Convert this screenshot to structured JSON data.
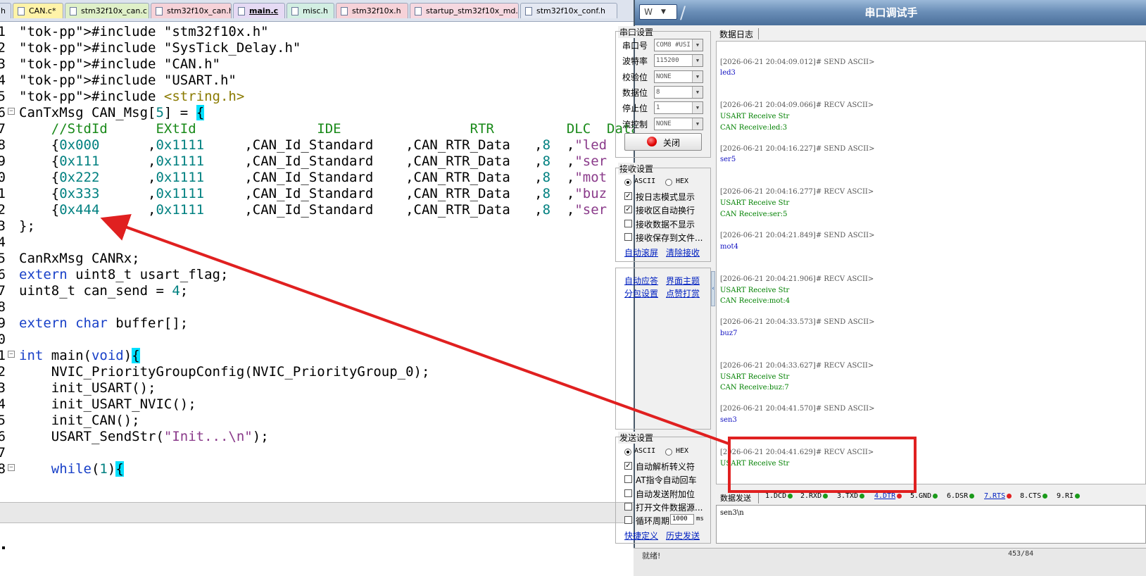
{
  "editor": {
    "tabs": [
      {
        "label": "h",
        "color": "#dde3ee"
      },
      {
        "label": "CAN.c*",
        "color": "#fff3a8"
      },
      {
        "label": "stm32f10x_can.c",
        "color": "#dff0c8"
      },
      {
        "label": "stm32f10x_can.h",
        "color": "#f6d2d8"
      },
      {
        "label": "main.c",
        "color": "#e6daf4"
      },
      {
        "label": "misc.h",
        "color": "#d2eee2"
      },
      {
        "label": "stm32f10x.h",
        "color": "#f6d2d8"
      },
      {
        "label": "startup_stm32f10x_md.s",
        "color": "#f6d8e0"
      },
      {
        "label": "stm32f10x_conf.h",
        "color": "#e4e8f2"
      }
    ],
    "lines": [
      {
        "num": "1",
        "text": "#include \"stm32f10x.h\""
      },
      {
        "num": "2",
        "text": "#include \"SysTick_Delay.h\""
      },
      {
        "num": "3",
        "text": "#include \"CAN.h\""
      },
      {
        "num": "4",
        "text": "#include \"USART.h\""
      },
      {
        "num": "5",
        "text": "#include <string.h>"
      },
      {
        "num": "6",
        "text": "CanTxMsg CAN_Msg[5] = {"
      },
      {
        "num": "7",
        "text": "    //StdId      EXtId               IDE                RTR         DLC  Data"
      },
      {
        "num": "8",
        "text": "    {0x000      ,0x1111     ,CAN_Id_Standard    ,CAN_RTR_Data   ,8  ,\"led"
      },
      {
        "num": "9",
        "text": "    {0x111      ,0x1111     ,CAN_Id_Standard    ,CAN_RTR_Data   ,8  ,\"ser"
      },
      {
        "num": "0",
        "text": "    {0x222      ,0x1111     ,CAN_Id_Standard    ,CAN_RTR_Data   ,8  ,\"mot"
      },
      {
        "num": "1",
        "text": "    {0x333      ,0x1111     ,CAN_Id_Standard    ,CAN_RTR_Data   ,8  ,\"buz"
      },
      {
        "num": "2",
        "text": "    {0x444      ,0x1111     ,CAN_Id_Standard    ,CAN_RTR_Data   ,8  ,\"ser"
      },
      {
        "num": "3",
        "text": "};"
      },
      {
        "num": "4",
        "text": ""
      },
      {
        "num": "5",
        "text": "CanRxMsg CANRx;"
      },
      {
        "num": "6",
        "text": "extern uint8_t usart_flag;"
      },
      {
        "num": "7",
        "text": "uint8_t can_send = 4;"
      },
      {
        "num": "8",
        "text": ""
      },
      {
        "num": "9",
        "text": "extern char buffer[];"
      },
      {
        "num": "0",
        "text": ""
      },
      {
        "num": "1",
        "text": "int main(void){"
      },
      {
        "num": "2",
        "text": "    NVIC_PriorityGroupConfig(NVIC_PriorityGroup_0);"
      },
      {
        "num": "3",
        "text": "    init_USART();"
      },
      {
        "num": "4",
        "text": "    init_USART_NVIC();"
      },
      {
        "num": "5",
        "text": "    init_CAN();"
      },
      {
        "num": "6",
        "text": "    USART_SendStr(\"Init...\\n\");"
      },
      {
        "num": "7",
        "text": ""
      },
      {
        "num": "8",
        "text": "    while(1){"
      }
    ]
  },
  "serial_tool": {
    "title": "串口调试手",
    "port_settings": {
      "title": "串口设置",
      "rows": [
        {
          "label": "串口号",
          "value": "COM8 #USI"
        },
        {
          "label": "波特率",
          "value": "115200"
        },
        {
          "label": "校验位",
          "value": "NONE"
        },
        {
          "label": "数据位",
          "value": "8"
        },
        {
          "label": "停止位",
          "value": "1"
        },
        {
          "label": "流控制",
          "value": "NONE"
        }
      ],
      "close_button": "关闭"
    },
    "recv_settings": {
      "title": "接收设置",
      "mode_ascii": "ASCII",
      "mode_hex": "HEX",
      "options": [
        {
          "label": "按日志模式显示",
          "checked": true
        },
        {
          "label": "接收区自动换行",
          "checked": true
        },
        {
          "label": "接收数据不显示",
          "checked": false
        },
        {
          "label": "接收保存到文件...",
          "checked": false
        }
      ],
      "link_scroll": "自动滚屏",
      "link_clear": "清除接收"
    },
    "extra_links": [
      "自动应答",
      "界面主题",
      "分包设置",
      "点赞打赏"
    ],
    "send_settings": {
      "title": "发送设置",
      "mode_ascii": "ASCII",
      "mode_hex": "HEX",
      "options": [
        {
          "label": "自动解析转义符",
          "checked": true
        },
        {
          "label": "AT指令自动回车",
          "checked": false
        },
        {
          "label": "自动发送附加位",
          "checked": false
        },
        {
          "label": "打开文件数据源...",
          "checked": false
        },
        {
          "label": "循环周期",
          "checked": false
        }
      ],
      "period_value": "1000",
      "period_unit": "ms",
      "link_shortcut": "快捷定义",
      "link_history": "历史发送"
    },
    "log_tab": "数据日志",
    "log": [
      {
        "type": "hdr",
        "text": "[2026-06-21 20:04:09.012]# SEND ASCII>"
      },
      {
        "type": "send",
        "text": "led3"
      },
      {
        "type": "hdr",
        "text": "[2026-06-21 20:04:09.066]# RECV ASCII>"
      },
      {
        "type": "recv",
        "text": "USART Receive Str"
      },
      {
        "type": "recv",
        "text": "CAN Receive:led:3"
      },
      {
        "type": "hdr",
        "text": "[2026-06-21 20:04:16.227]# SEND ASCII>"
      },
      {
        "type": "send",
        "text": "ser5"
      },
      {
        "type": "hdr",
        "text": "[2026-06-21 20:04:16.277]# RECV ASCII>"
      },
      {
        "type": "recv",
        "text": "USART Receive Str"
      },
      {
        "type": "recv",
        "text": "CAN Receive:ser:5"
      },
      {
        "type": "hdr",
        "text": "[2026-06-21 20:04:21.849]# SEND ASCII>"
      },
      {
        "type": "send",
        "text": "mot4"
      },
      {
        "type": "hdr",
        "text": "[2026-06-21 20:04:21.906]# RECV ASCII>"
      },
      {
        "type": "recv",
        "text": "USART Receive Str"
      },
      {
        "type": "recv",
        "text": "CAN Receive:mot:4"
      },
      {
        "type": "hdr",
        "text": "[2026-06-21 20:04:33.573]# SEND ASCII>"
      },
      {
        "type": "send",
        "text": "buz7"
      },
      {
        "type": "hdr",
        "text": "[2026-06-21 20:04:33.627]# RECV ASCII>"
      },
      {
        "type": "recv",
        "text": "USART Receive Str"
      },
      {
        "type": "recv",
        "text": "CAN Receive:buz:7"
      },
      {
        "type": "hdr",
        "text": "[2026-06-21 20:04:41.570]# SEND ASCII>"
      },
      {
        "type": "send",
        "text": "sen3"
      },
      {
        "type": "hdr",
        "text": "[2026-06-21 20:04:41.629]# RECV ASCII>"
      },
      {
        "type": "recv",
        "text": "USART Receive Str"
      }
    ],
    "send_tab": "数据发送",
    "signals": [
      {
        "label": "1.DCD",
        "led": "#1a9a1a",
        "link": false
      },
      {
        "label": "2.RXD",
        "led": "#1a9a1a",
        "link": false
      },
      {
        "label": "3.TXD",
        "led": "#1a9a1a",
        "link": false
      },
      {
        "label": "4.DTR",
        "led": "#e02020",
        "link": true
      },
      {
        "label": "5.GND",
        "led": "#1a9a1a",
        "link": false
      },
      {
        "label": "6.DSR",
        "led": "#1a9a1a",
        "link": false
      },
      {
        "label": "7.RTS",
        "led": "#e02020",
        "link": true
      },
      {
        "label": "8.CTS",
        "led": "#1a9a1a",
        "link": false
      },
      {
        "label": "9.RI",
        "led": "#1a9a1a",
        "link": false
      }
    ],
    "send_text": "sen3\\n",
    "status_left": "就绪!",
    "status_right": "453/84"
  },
  "annotation": {
    "color": "#e02020"
  }
}
